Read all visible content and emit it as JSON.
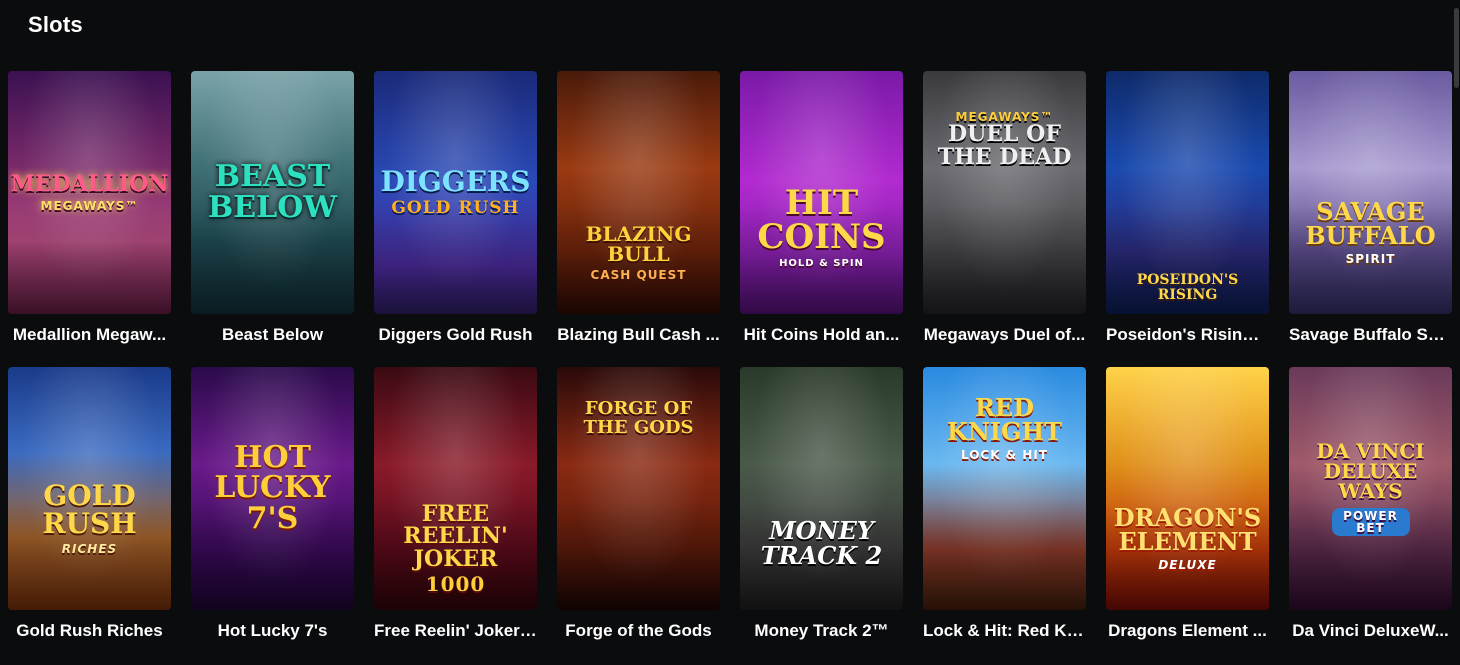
{
  "section": {
    "title": "Slots"
  },
  "games": [
    {
      "caption": "Medallion Megaw...",
      "art_title": "Medallion",
      "art_sub": "Megaways™"
    },
    {
      "caption": "Beast Below",
      "art_title": "Beast\nBelow",
      "art_sub": ""
    },
    {
      "caption": "Diggers Gold Rush",
      "art_title": "Diggers",
      "art_sub": "Gold Rush"
    },
    {
      "caption": "Blazing Bull Cash ...",
      "art_title": "Blazing Bull",
      "art_sub": "Cash Quest"
    },
    {
      "caption": "Hit Coins Hold an...",
      "art_title": "Hit\nCoins",
      "art_sub": "Hold & Spin"
    },
    {
      "caption": "Megaways Duel of...",
      "art_title": "Duel of\nthe Dead",
      "art_sub": "Megaways™"
    },
    {
      "caption": "Poseidon's Rising ...",
      "art_title": "Poseidon's Rising",
      "art_sub": ""
    },
    {
      "caption": "Savage Buffalo Sp...",
      "art_title": "Savage\nBuffalo",
      "art_sub": "Spirit"
    },
    {
      "caption": "Gold Rush Riches",
      "art_title": "Gold\nRush",
      "art_sub": "Riches"
    },
    {
      "caption": "Hot Lucky 7's",
      "art_title": "Hot\nLucky\n7's",
      "art_sub": ""
    },
    {
      "caption": "Free Reelin' Joker ...",
      "art_title": "Free Reelin' Joker",
      "art_sub": "1000"
    },
    {
      "caption": "Forge of the Gods",
      "art_title": "Forge of\nthe Gods",
      "art_sub": ""
    },
    {
      "caption": "Money Track 2™",
      "art_title": "Money\nTrack 2",
      "art_sub": ""
    },
    {
      "caption": "Lock & Hit: Red Kn...",
      "art_title": "Red\nKnight",
      "art_sub": "Lock & Hit"
    },
    {
      "caption": "Dragons Element ...",
      "art_title": "Dragon's\nElement",
      "art_sub": "Deluxe"
    },
    {
      "caption": "Da Vinci DeluxeW...",
      "art_title": "Da Vinci\nDeluxe Ways",
      "art_sub": "Power Bet"
    }
  ]
}
